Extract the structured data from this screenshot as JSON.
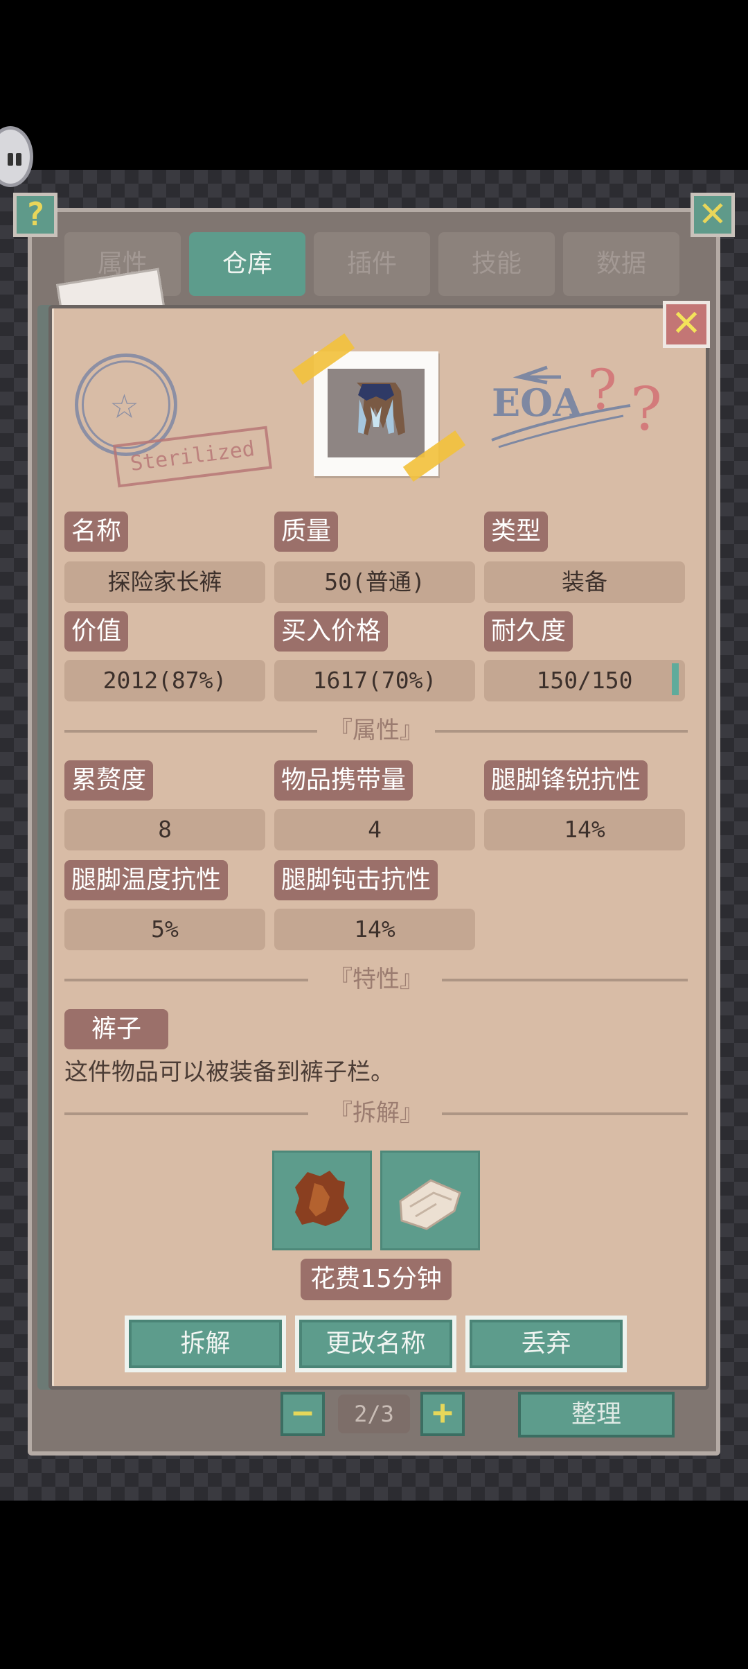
{
  "tabs": [
    {
      "label": "属性"
    },
    {
      "label": "仓库"
    },
    {
      "label": "插件"
    },
    {
      "label": "技能"
    },
    {
      "label": "数据"
    }
  ],
  "help_icon": "?",
  "close_icon": "✕",
  "stamp": {
    "text": "Sterilized"
  },
  "scribble": {
    "text": "EOA"
  },
  "info": {
    "name_label": "名称",
    "name_value": "探险家长裤",
    "quality_label": "质量",
    "quality_value": "50(普通)",
    "type_label": "类型",
    "type_value": "装备",
    "value_label": "价值",
    "value_value": "2012(87%)",
    "buy_label": "买入价格",
    "buy_value": "1617(70%)",
    "durability_label": "耐久度",
    "durability_value": "150/150"
  },
  "durability_fill": 1.0,
  "sections": {
    "attributes": "『属性』",
    "traits": "『特性』",
    "dismantle": "『拆解』"
  },
  "attributes": [
    {
      "label": "累赘度",
      "value": "8"
    },
    {
      "label": "物品携带量",
      "value": "4"
    },
    {
      "label": "腿脚锋锐抗性",
      "value": "14%"
    },
    {
      "label": "腿脚温度抗性",
      "value": "5%"
    },
    {
      "label": "腿脚钝击抗性",
      "value": "14%"
    }
  ],
  "trait": {
    "tag": "裤子",
    "description": "这件物品可以被装备到裤子栏。"
  },
  "dismantle": {
    "materials": [
      {
        "icon": "leather-scrap-icon"
      },
      {
        "icon": "cloth-scrap-icon"
      }
    ],
    "cost": "花费15分钟"
  },
  "actions": {
    "dismantle": "拆解",
    "rename": "更改名称",
    "discard": "丢弃"
  },
  "pager": {
    "minus": "−",
    "plus": "+",
    "indicator": "2/3",
    "sort": "整理"
  },
  "colors": {
    "teal": "#5d9c8c",
    "card": "#d8bca6",
    "label": "#9b706a",
    "accent_yellow": "#e9d65a"
  }
}
